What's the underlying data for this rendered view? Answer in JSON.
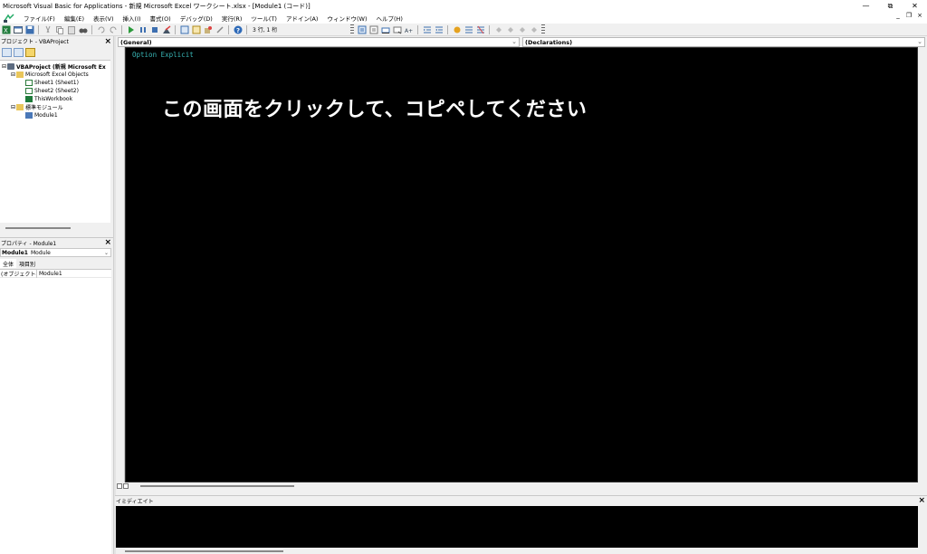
{
  "window": {
    "title": "Microsoft Visual Basic for Applications - 新規 Microsoft Excel ワークシート.xlsx - [Module1 (コード)]",
    "minimize": "—",
    "restore": "⧉",
    "close": "✕"
  },
  "menu": {
    "items": [
      "ファイル(F)",
      "編集(E)",
      "表示(V)",
      "挿入(I)",
      "書式(O)",
      "デバッグ(D)",
      "実行(R)",
      "ツール(T)",
      "アドイン(A)",
      "ウィンドウ(W)",
      "ヘルプ(H)"
    ],
    "mdi_min": "_",
    "mdi_restore": "❐",
    "mdi_close": "×"
  },
  "toolbar": {
    "cursor_position": "3 行, 1 桁"
  },
  "project": {
    "header": "プロジェクト - VBAProject",
    "close": "×",
    "tree": {
      "root": "VBAProject (新規 Microsoft Ex",
      "folder_objects": "Microsoft Excel Objects",
      "sheet1": "Sheet1 (Sheet1)",
      "sheet2": "Sheet2 (Sheet2)",
      "workbook": "ThisWorkbook",
      "folder_modules": "標準モジュール",
      "module1": "Module1"
    }
  },
  "properties": {
    "header": "プロパティ - Module1",
    "close": "×",
    "object_name": "Module1",
    "object_type": "Module",
    "tab_all": "全体",
    "tab_category": "項目別",
    "rows": [
      {
        "key": "(オブジェクト名)",
        "value": "Module1"
      }
    ]
  },
  "code": {
    "object_combo": "(General)",
    "proc_combo": "(Declarations)",
    "line1": "Option Explicit",
    "overlay": "この画面をクリックして、コピペしてください"
  },
  "immediate": {
    "header": "イミディエイト",
    "close": "×"
  },
  "colors": {
    "code_bg": "#000000",
    "keyword": "#39b8b8",
    "overlay_text": "#ffffff"
  }
}
